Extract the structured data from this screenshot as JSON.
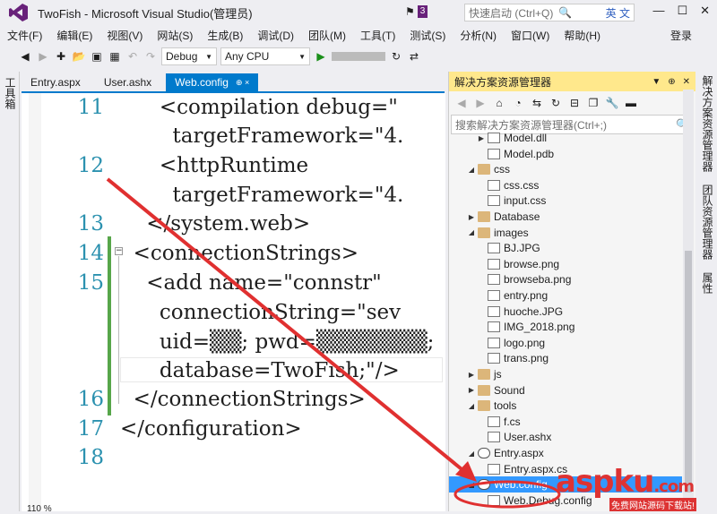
{
  "window": {
    "title": "TwoFish - Microsoft Visual Studio(管理员)",
    "notifications": "3",
    "quicklaunch_placeholder": "快速启动 (Ctrl+Q)",
    "ime": "英 文",
    "controls": [
      "—",
      "☐",
      "✕"
    ]
  },
  "menu": {
    "items": [
      "文件(F)",
      "编辑(E)",
      "视图(V)",
      "网站(S)",
      "生成(B)",
      "调试(D)",
      "团队(M)",
      "工具(T)",
      "测试(S)",
      "分析(N)",
      "窗口(W)",
      "帮助(H)"
    ],
    "login": "登录"
  },
  "toolbar": {
    "config": "Debug",
    "platform": "Any CPU"
  },
  "left_strip": {
    "label": "工具箱"
  },
  "tabs": [
    {
      "label": "Entry.aspx"
    },
    {
      "label": "User.ashx"
    },
    {
      "label": "Web.config",
      "pin": "⊕ ×"
    }
  ],
  "editor": {
    "lines": [
      {
        "n": "11",
        "code": "      <compilation debug=\""
      },
      {
        "n": "",
        "code": "        targetFramework=\"4."
      },
      {
        "n": "12",
        "code": "      <httpRuntime"
      },
      {
        "n": "",
        "code": "        targetFramework=\"4."
      },
      {
        "n": "13",
        "code": "    </system.web>"
      },
      {
        "n": "14",
        "code": "  <connectionStrings>"
      },
      {
        "n": "15",
        "code": "    <add name=\"connstr\""
      },
      {
        "n": "",
        "code": "      connectionString=\"sev"
      },
      {
        "n": "",
        "code": "      uid=▒▒; pwd=▒▒▒▒▒▒▒;"
      },
      {
        "n": "",
        "code": "      database=TwoFish;\"/>"
      },
      {
        "n": "16",
        "code": "  </connectionStrings>"
      },
      {
        "n": "17",
        "code": "</configuration>"
      },
      {
        "n": "18",
        "code": ""
      }
    ],
    "zoom": "110 %"
  },
  "solution_explorer": {
    "title": "解决方案资源管理器",
    "search_placeholder": "搜索解决方案资源管理器(Ctrl+;)",
    "items": [
      {
        "label": "Model.dll",
        "icon": "dll",
        "indent": 3,
        "tw": "▶"
      },
      {
        "label": "Model.pdb",
        "icon": "doc",
        "indent": 3,
        "tw": ""
      },
      {
        "label": "css",
        "icon": "folder",
        "indent": 2,
        "tw": "◢"
      },
      {
        "label": "css.css",
        "icon": "doc",
        "indent": 3,
        "tw": ""
      },
      {
        "label": "input.css",
        "icon": "doc",
        "indent": 3,
        "tw": ""
      },
      {
        "label": "Database",
        "icon": "folder",
        "indent": 2,
        "tw": "▶"
      },
      {
        "label": "images",
        "icon": "folder",
        "indent": 2,
        "tw": "◢"
      },
      {
        "label": "BJ.JPG",
        "icon": "image",
        "indent": 3,
        "tw": ""
      },
      {
        "label": "browse.png",
        "icon": "image",
        "indent": 3,
        "tw": ""
      },
      {
        "label": "browseba.png",
        "icon": "image",
        "indent": 3,
        "tw": ""
      },
      {
        "label": "entry.png",
        "icon": "image",
        "indent": 3,
        "tw": ""
      },
      {
        "label": "huoche.JPG",
        "icon": "image",
        "indent": 3,
        "tw": ""
      },
      {
        "label": "IMG_2018.png",
        "icon": "image",
        "indent": 3,
        "tw": ""
      },
      {
        "label": "logo.png",
        "icon": "image",
        "indent": 3,
        "tw": ""
      },
      {
        "label": "trans.png",
        "icon": "image",
        "indent": 3,
        "tw": ""
      },
      {
        "label": "js",
        "icon": "folder",
        "indent": 2,
        "tw": "▶"
      },
      {
        "label": "Sound",
        "icon": "folder",
        "indent": 2,
        "tw": "▶"
      },
      {
        "label": "tools",
        "icon": "folder",
        "indent": 2,
        "tw": "◢"
      },
      {
        "label": "f.cs",
        "icon": "cs",
        "indent": 3,
        "tw": ""
      },
      {
        "label": "User.ashx",
        "icon": "doc",
        "indent": 3,
        "tw": ""
      },
      {
        "label": "Entry.aspx",
        "icon": "web",
        "indent": 2,
        "tw": "◢"
      },
      {
        "label": "Entry.aspx.cs",
        "icon": "cs",
        "indent": 3,
        "tw": ""
      },
      {
        "label": "Web.config",
        "icon": "web",
        "indent": 2,
        "tw": "◢",
        "selected": true
      },
      {
        "label": "Web.Debug.config",
        "icon": "doc",
        "indent": 3,
        "tw": ""
      }
    ]
  },
  "right_strip": {
    "labels": [
      "解决方案资源管理器",
      "团队资源管理器",
      "属性"
    ]
  },
  "watermark": {
    "brand": "aspku",
    "tld": ".com",
    "sub": "免费网站源码下载站!"
  },
  "colors": {
    "accent": "#007acc",
    "panel_header": "#ffe88c",
    "selection": "#3399ff",
    "arrow": "#e03030"
  }
}
